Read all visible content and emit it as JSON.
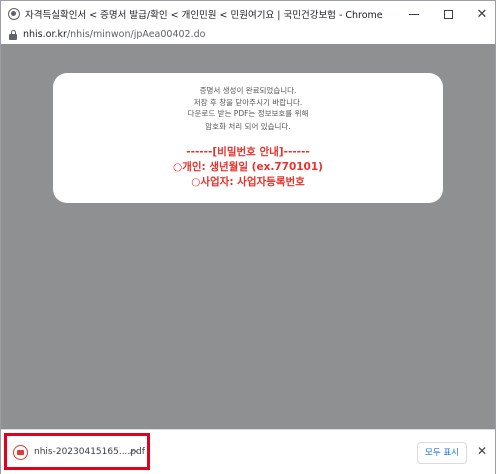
{
  "window": {
    "title": "자격득실확인서 < 증명서 발급/확인 < 개인민원 < 민원여기요 | 국민건강보험 - Chrome",
    "minimize_glyph": "–",
    "maximize_glyph": "☐",
    "close_glyph": "✕"
  },
  "addressbar": {
    "host": "nhis.or.kr",
    "path": "/nhis/minwon/jpAea00402.do"
  },
  "modal": {
    "message_lines": [
      "증명서 생성이 완료되었습니다.",
      "저장 후 창을 닫아주시기 바랍니다.",
      "다운로드 받는 PDF는 정보보호를 위해",
      "암호화 처리 되어 있습니다."
    ],
    "notice_lines": [
      "------[비밀번호 안내]------",
      "○개인: 생년월일 (ex.770101)",
      "○사업자: 사업자등록번호"
    ],
    "notice_color": "#e8312c"
  },
  "download_shelf": {
    "file_name": "nhis-20230415165....pdf",
    "file_icon": "pdf-file-icon",
    "show_all_label": "모두 표시",
    "close_glyph": "✕",
    "highlight_color": "#e3001b"
  },
  "colors": {
    "page_overlay": "#8e9092",
    "link_blue": "#1a73e8"
  }
}
